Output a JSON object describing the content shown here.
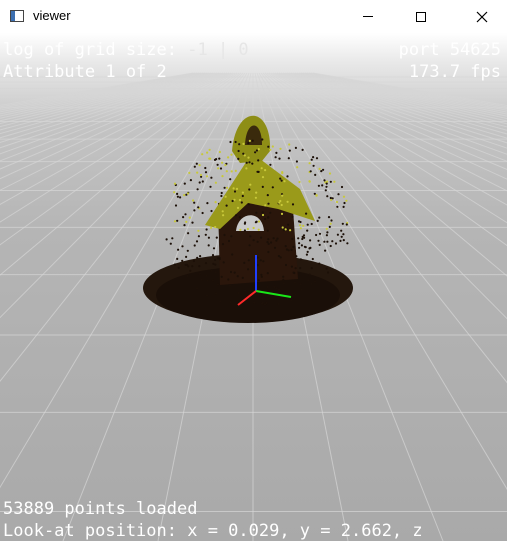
{
  "window": {
    "title": "viewer",
    "controls": {
      "minimize": "minimize",
      "maximize": "maximize",
      "close": "close"
    }
  },
  "overlay": {
    "grid_label": "log of grid size:",
    "grid_value": "-1 | 0",
    "port": "port 54625",
    "attribute": "Attribute 1 of 2",
    "fps": "173.7 fps",
    "points_loaded": "53889 points loaded",
    "look_at": "Look-at position: x = 0.029, y = 2.662, z"
  },
  "scene": {
    "object": "point cloud of small house with yellow roof",
    "axes_colors": {
      "x": "#ff2a2a",
      "y": "#19e619",
      "z": "#1f3fff"
    },
    "colors": {
      "roof": "#9a9a1a",
      "roof_highlight": "#cfcf45",
      "body": "#2a160b",
      "base": "#24170d"
    }
  }
}
